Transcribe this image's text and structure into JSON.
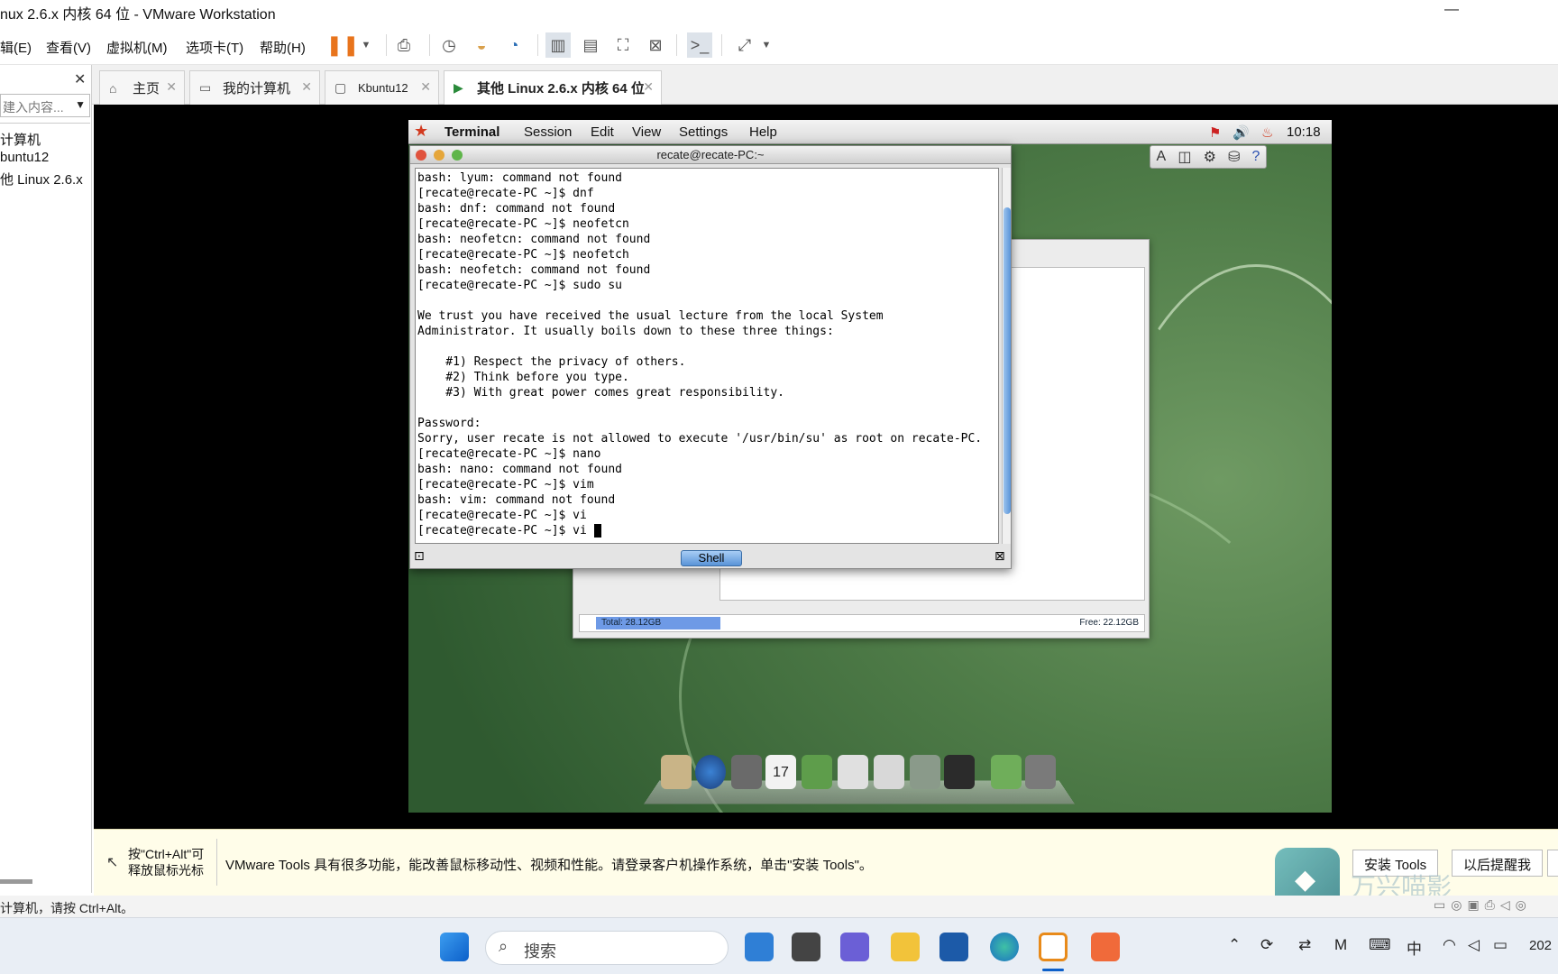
{
  "window": {
    "title": "nux 2.6.x 内核 64 位 - VMware Workstation",
    "minimize": "—"
  },
  "menu": [
    "辑(E)",
    "查看(V)",
    "虚拟机(M)",
    "选项卡(T)",
    "帮助(H)"
  ],
  "sidebar": {
    "close": "✕",
    "search_placeholder": "建入内容...",
    "items": [
      "计算机",
      "buntu12",
      "他 Linux 2.6.x"
    ]
  },
  "tabs": [
    {
      "label": "主页",
      "icon": "home-icon"
    },
    {
      "label": "我的计算机",
      "icon": "computer-icon"
    },
    {
      "label": "Kbuntu12",
      "icon": "vm-icon"
    },
    {
      "label": "其他 Linux 2.6.x 内核 64 位",
      "icon": "vm-running-icon"
    }
  ],
  "guest": {
    "panel": {
      "app": "Terminal",
      "menus": [
        "Session",
        "Edit",
        "View",
        "Settings",
        "Help"
      ],
      "clock": "10:18"
    },
    "terminal": {
      "title": "recate@recate-PC:~",
      "lines": [
        "bash: lyum: command not found",
        "[recate@recate-PC ~]$ dnf",
        "bash: dnf: command not found",
        "[recate@recate-PC ~]$ neofetcn",
        "bash: neofetcn: command not found",
        "[recate@recate-PC ~]$ neofetch",
        "bash: neofetch: command not found",
        "[recate@recate-PC ~]$ sudo su",
        "",
        "We trust you have received the usual lecture from the local System",
        "Administrator. It usually boils down to these three things:",
        "",
        "    #1) Respect the privacy of others.",
        "    #2) Think before you type.",
        "    #3) With great power comes great responsibility.",
        "",
        "Password:",
        "Sorry, user recate is not allowed to execute '/usr/bin/su' as root on recate-PC.",
        "[recate@recate-PC ~]$ nano",
        "bash: nano: command not found",
        "[recate@recate-PC ~]$ vim",
        "bash: vim: command not found",
        "[recate@recate-PC ~]$ vi",
        "[recate@recate-PC ~]$ vi "
      ],
      "shell_tab": "Shell"
    },
    "filemanager": {
      "total": "Total: 28.12GB",
      "free": "Free: 22.12GB",
      "used_fraction": 0.22
    }
  },
  "notification": {
    "hint_line1": "按\"Ctrl+Alt\"可",
    "hint_line2": "释放鼠标光标",
    "message": "VMware Tools 具有很多功能，能改善鼠标移动性、视频和性能。请登录客户机操作系统，单击\"安装 Tools\"。",
    "install_button": "安装 Tools",
    "later_button": "以后提醒我",
    "watermark": "万兴喵影"
  },
  "statusline": "计算机，请按 Ctrl+Alt。",
  "taskbar": {
    "search": "搜索",
    "ime": "中",
    "clock": "202"
  }
}
